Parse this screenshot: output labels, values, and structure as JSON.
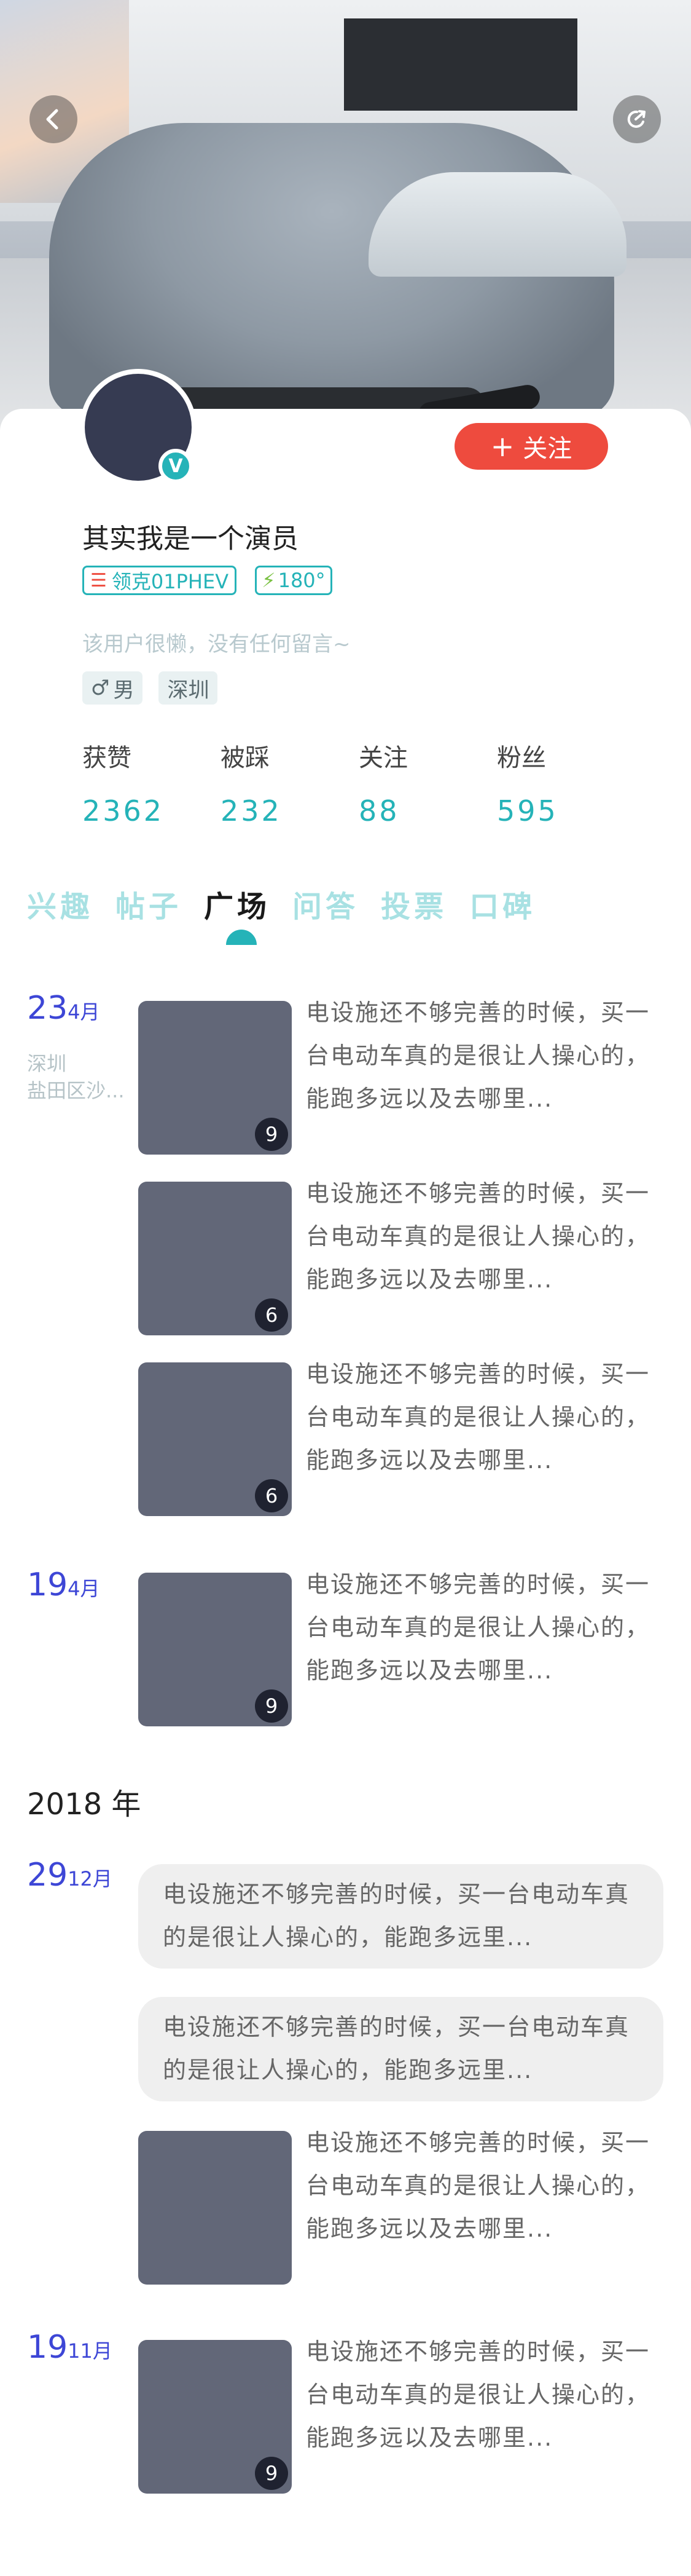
{
  "profile": {
    "name": "其实我是一个演员",
    "verified_mark": "V",
    "follow_label": "关注",
    "follow_plus": "+",
    "car_tag": "领克01PHEV",
    "charge_tag": "180°",
    "bio": "该用户很懒，没有任何留言~",
    "gender_symbol": "♂",
    "gender": "男",
    "city": "深圳"
  },
  "stats": [
    {
      "label": "获赞",
      "value": "2362"
    },
    {
      "label": "被踩",
      "value": "232"
    },
    {
      "label": "关注",
      "value": "88"
    },
    {
      "label": "粉丝",
      "value": "595"
    }
  ],
  "tabs": [
    "兴趣",
    "帖子",
    "广场",
    "问答",
    "投票",
    "口碑"
  ],
  "active_tab": "广场",
  "timeline": {
    "g1": {
      "day": "23",
      "month": "4月",
      "loc1": "深圳",
      "loc2": "盐田区沙..."
    },
    "g2": {
      "day": "19",
      "month": "4月"
    },
    "year": "2018 年",
    "g3": {
      "day": "29",
      "month": "12月"
    },
    "g4": {
      "day": "19",
      "month": "11月"
    }
  },
  "post_text": "电设施还不够完善的时候，买一台电动车真的是很让人操心的，能跑多远以及去哪里...",
  "bubble_text": "电设施还不够完善的时候，买一台电动车真的是很让人操心的，能跑多远里...",
  "counts": [
    "9",
    "6",
    "6",
    "9",
    "9"
  ],
  "colors": {
    "accent": "#25b3b8",
    "follow": "#ee4b3e",
    "date": "#3d46d6"
  },
  "icons": [
    "back-icon",
    "share-icon"
  ]
}
